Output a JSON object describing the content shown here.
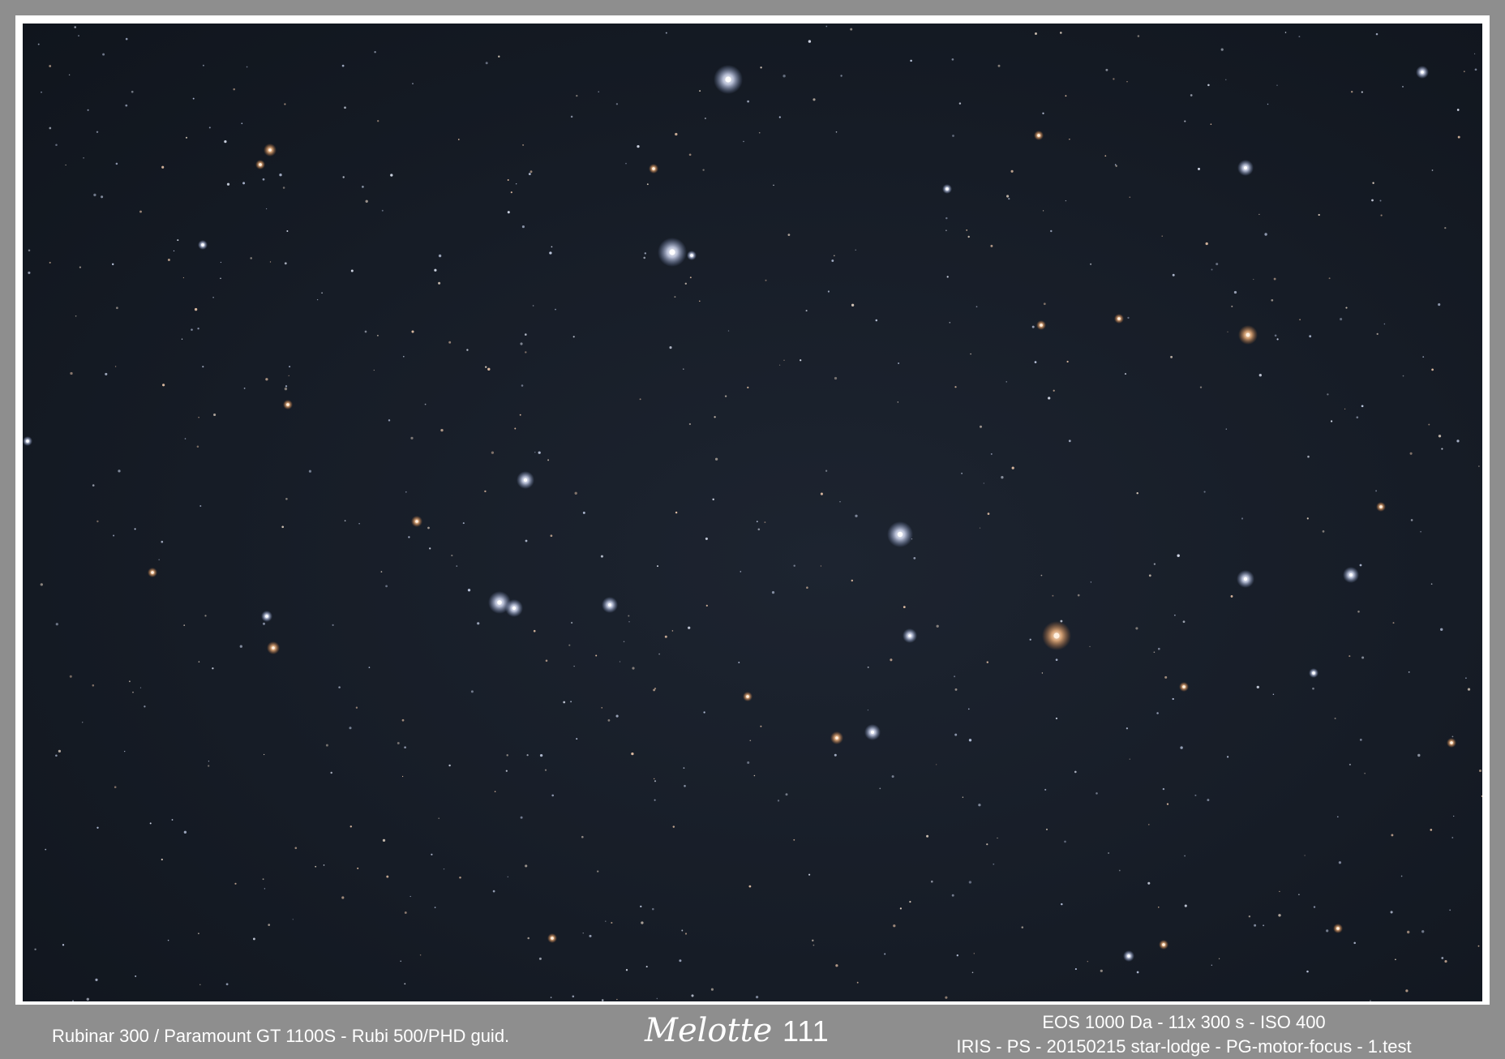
{
  "image": {
    "subject": "Melotte 111",
    "title_script": "Melotte",
    "title_number": "111"
  },
  "captions": {
    "left": "Rubinar 300 / Paramount GT 1100S  - Rubi 500/PHD guid.",
    "right_line1": "EOS 1000 Da - 11x 300 s - ISO 400",
    "right_line2": "IRIS - PS - 20150215  star-lodge - PG-motor-focus - 1.test"
  },
  "colors": {
    "border": "#8e8e8e",
    "frame": "#ffffff",
    "sky": "#161c26",
    "star_white": "#f2f4ff",
    "star_blue": "#c9d6ff",
    "star_orange": "#ffb27a"
  }
}
